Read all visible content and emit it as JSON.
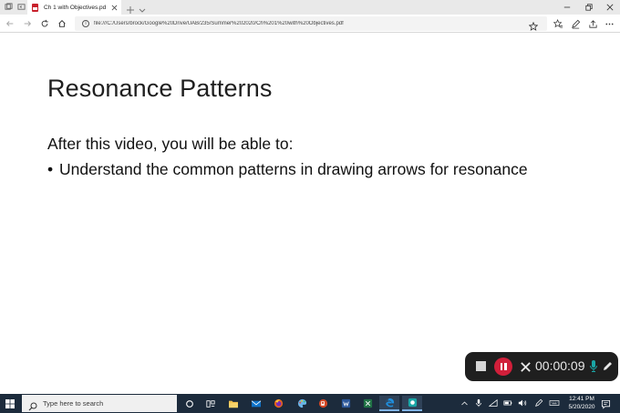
{
  "browser": {
    "tab": {
      "title": "Ch 1 with Objectives.pd",
      "close_label": "×"
    },
    "address": {
      "url": "file:///C:/Users/brock/Google%20Drive/UAB/235/Summer%202020/Ch%201%20with%20Objectives.pdf"
    }
  },
  "slide": {
    "title": "Resonance Patterns",
    "intro": "After this video, you will be able to:",
    "bullets": [
      {
        "marker": "•",
        "text": "Understand the common patterns in drawing arrows for resonance"
      }
    ]
  },
  "recorder": {
    "timer": "00:00:09",
    "colors": {
      "background": "#1f1f1f",
      "pause": "#d11f3a",
      "mic": "#1aa6a6"
    }
  },
  "taskbar": {
    "search_placeholder": "Type here to search",
    "clock": {
      "time": "12:41 PM",
      "date": "5/20/2020"
    },
    "apps": [
      "task-view",
      "file-explorer",
      "mail",
      "firefox",
      "powerpoint",
      "word",
      "excel",
      "edge",
      "screen-recorder"
    ]
  },
  "colors": {
    "taskbar": "#1c2b3c",
    "tab_strip": "#e9e9e9",
    "pdf_icon": "#c8202b"
  }
}
